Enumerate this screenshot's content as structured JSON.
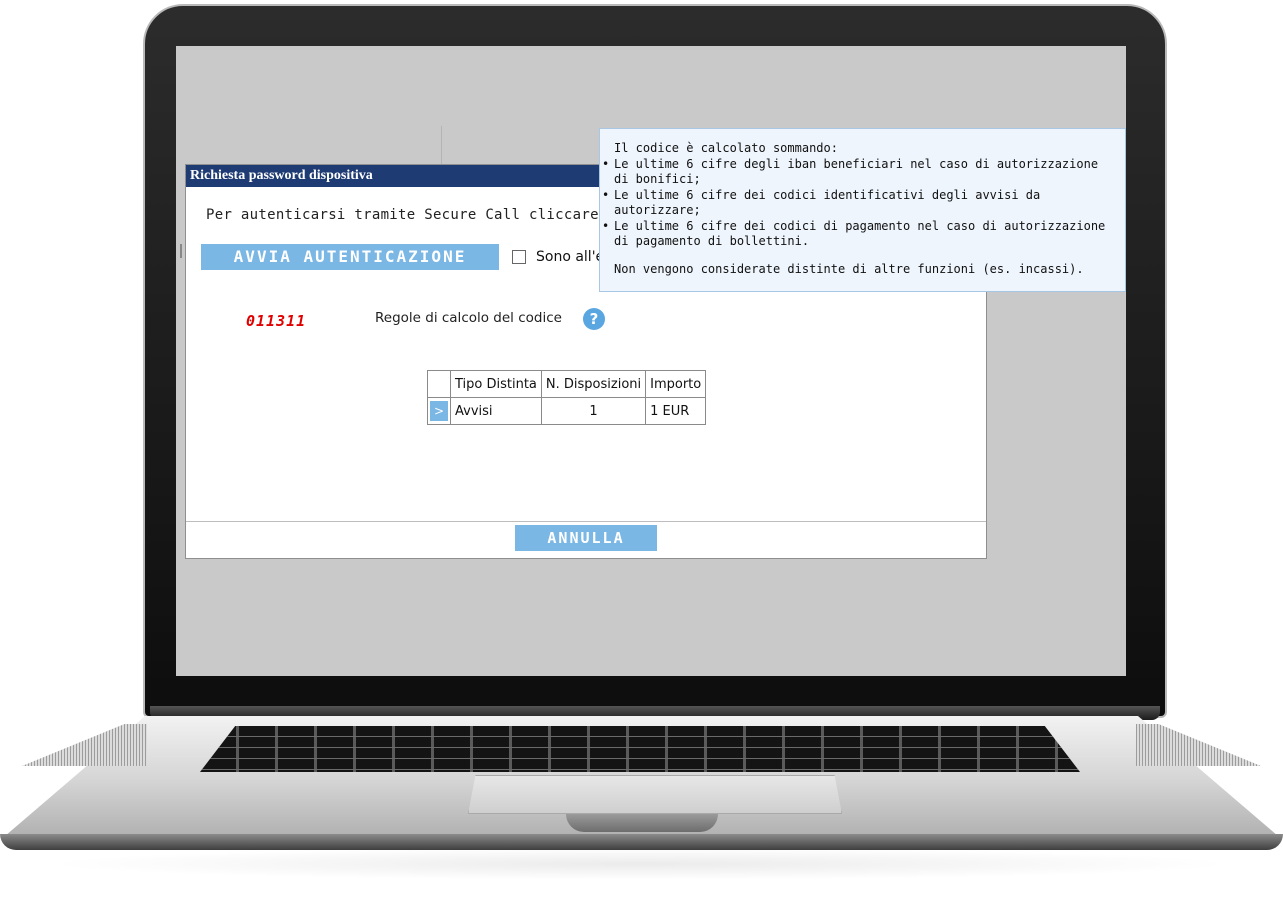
{
  "dialog": {
    "title": "Richiesta password dispositiva",
    "intro": "Per autenticarsi tramite Secure Call cliccare s",
    "start_button": "AVVIA AUTENTICAZIONE",
    "abroad_label": "Sono all'estero",
    "code": "011311",
    "rules_label": "Regole di calcolo del codice",
    "help_icon": "question-circle-icon",
    "cancel_button": "ANNULLA"
  },
  "table": {
    "headers": [
      "",
      "Tipo Distinta",
      "N. Disposizioni",
      "Importo"
    ],
    "rows": [
      {
        "arrow": ">",
        "tipo": "Avvisi",
        "n": "1",
        "importo": "1 EUR"
      }
    ]
  },
  "tooltip": {
    "intro": "Il codice è calcolato sommando:",
    "items": [
      "Le ultime 6 cifre degli iban beneficiari nel caso di autorizzazione di bonifici;",
      "Le ultime 6 cifre dei codici identificativi degli avvisi da autorizzare;",
      "Le ultime 6 cifre dei codici di pagamento nel caso di autorizzazione di pagamento di bollettini."
    ],
    "note": "Non vengono considerate distinte di altre funzioni (es. incassi)."
  },
  "colors": {
    "title_bar": "#1f3b73",
    "button": "#7ab7e4",
    "code": "#e00000",
    "tooltip_bg": "#eef5fd"
  }
}
